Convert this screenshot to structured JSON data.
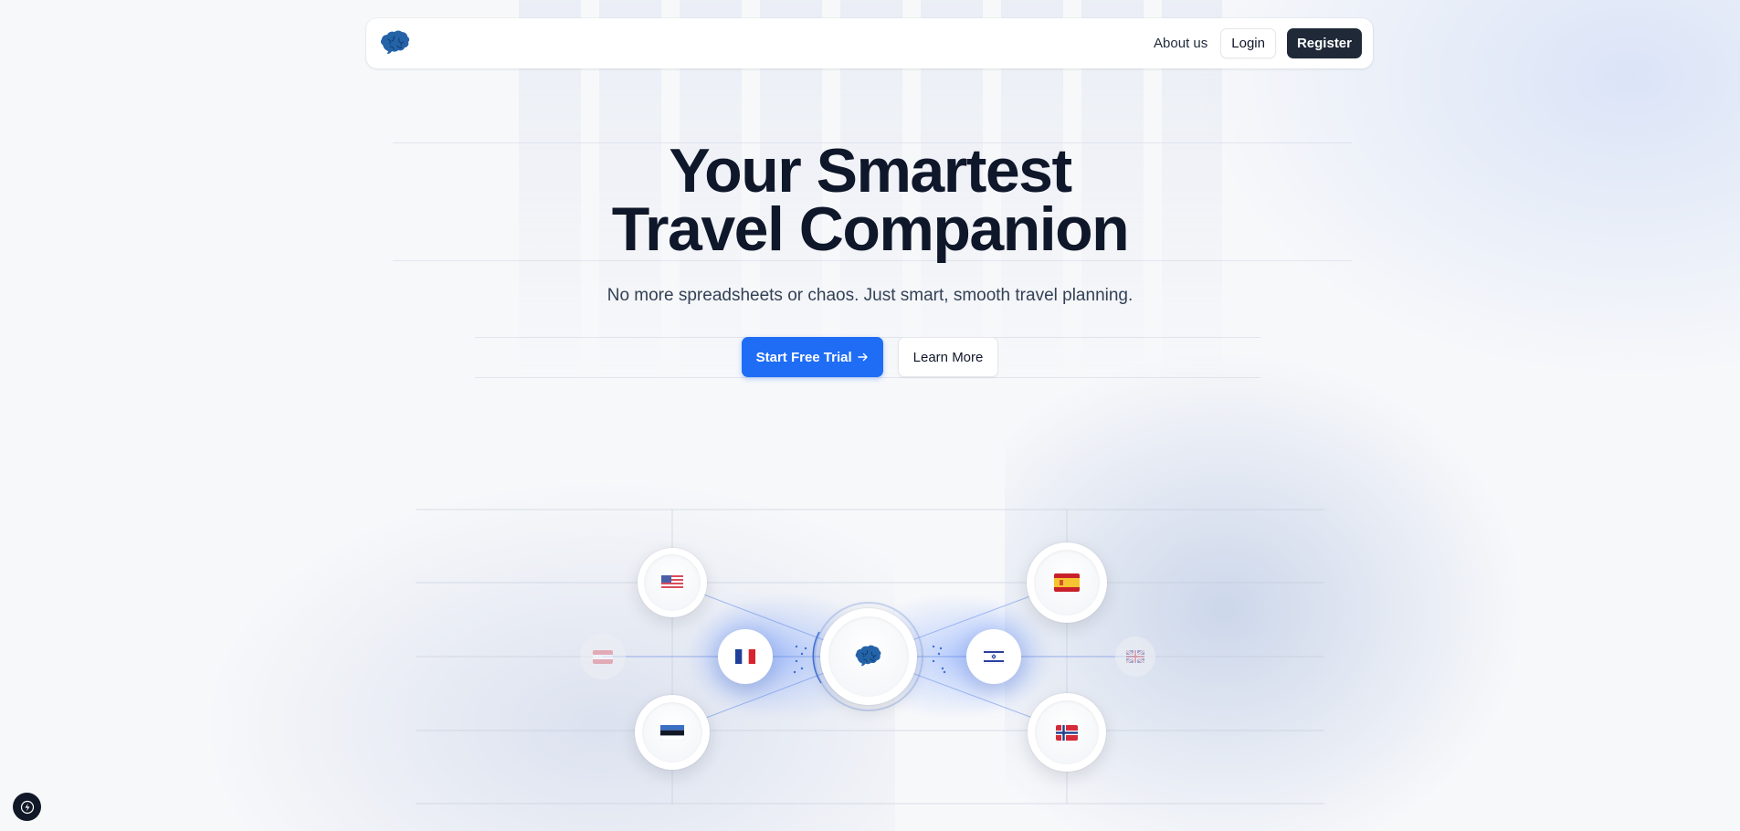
{
  "nav": {
    "about_label": "About us",
    "login_label": "Login",
    "register_label": "Register"
  },
  "hero": {
    "title_line1": "Your Smartest",
    "title_line2": "Travel Companion",
    "subtitle": "No more spreadsheets or chaos. Just smart, smooth travel planning.",
    "primary_cta": "Start Free Trial",
    "primary_cta_icon": "arrow-right-icon",
    "secondary_cta": "Learn More"
  },
  "diagram": {
    "center_icon": "brain-icon",
    "flags": [
      "united-states",
      "spain",
      "austria",
      "france",
      "israel",
      "united-kingdom",
      "estonia",
      "norway"
    ]
  },
  "colors": {
    "primary": "#1f6df5",
    "dark": "#1f2937",
    "text": "#0f172a",
    "brain": "#2563a8"
  }
}
